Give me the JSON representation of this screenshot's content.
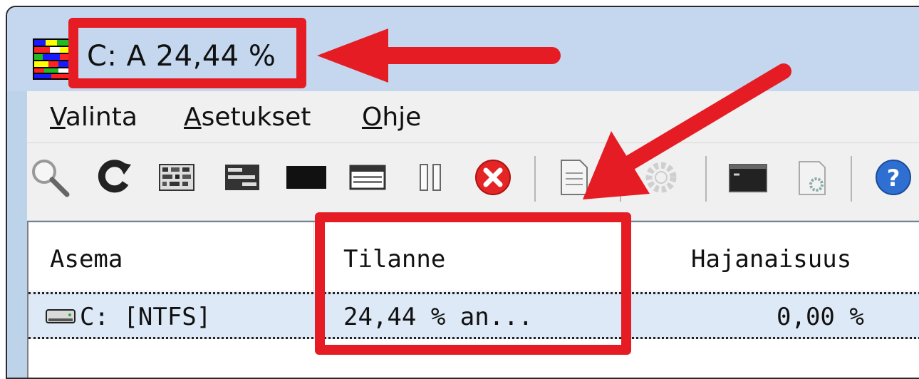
{
  "window": {
    "title": "C: A 24,44 %",
    "icon": "defrag-app-icon"
  },
  "menu": {
    "items": [
      {
        "mnemonic": "V",
        "rest": "alinta"
      },
      {
        "mnemonic": "A",
        "rest": "setukset"
      },
      {
        "mnemonic": "O",
        "rest": "hje"
      }
    ]
  },
  "toolbar": {
    "icons": [
      "magnifier-icon",
      "refresh-icon",
      "defrag-pattern-icon",
      "defrag-lines-icon",
      "black-block-icon",
      "window-block-icon",
      "pause-icon",
      "stop-icon",
      "document-icon",
      "gear-icon",
      "console-icon",
      "settings-doc-icon",
      "help-icon"
    ]
  },
  "list": {
    "columns": [
      "Asema",
      "Tilanne",
      "Hajanaisuus"
    ],
    "rows": [
      {
        "drive": "C: [NTFS]",
        "status": "24,44 % an...",
        "fragmentation": "0,00 %"
      }
    ]
  },
  "annotations": {
    "color": "#e51c23"
  }
}
